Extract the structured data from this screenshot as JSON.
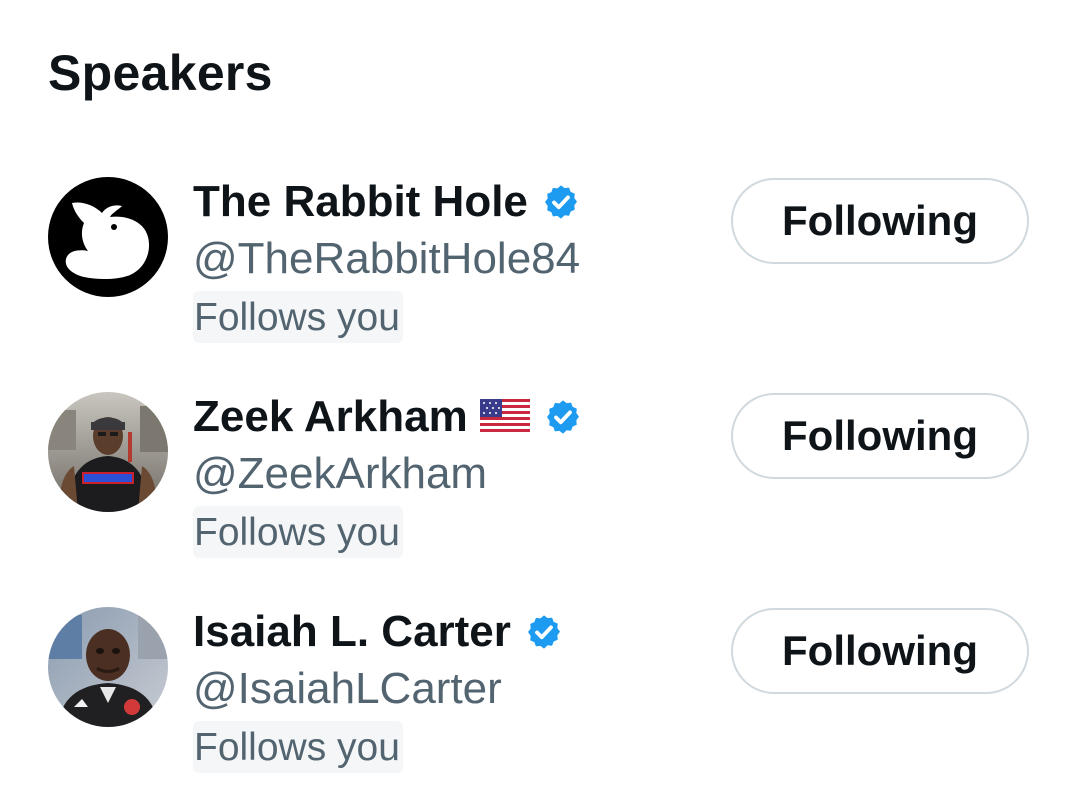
{
  "section": {
    "title": "Speakers"
  },
  "speakers": [
    {
      "display_name": "The Rabbit Hole",
      "handle": "@TheRabbitHole84",
      "follows_you": "Follows you",
      "button_label": "Following",
      "verified": true,
      "avatar_icon": "rabbit-logo",
      "flag_icon": null
    },
    {
      "display_name": "Zeek Arkham",
      "handle": "@ZeekArkham",
      "follows_you": "Follows you",
      "button_label": "Following",
      "verified": true,
      "avatar_icon": "user-photo",
      "flag_icon": "us-flag"
    },
    {
      "display_name": "Isaiah L. Carter",
      "handle": "@IsaiahLCarter",
      "follows_you": "Follows you",
      "button_label": "Following",
      "verified": true,
      "avatar_icon": "user-photo",
      "flag_icon": null
    }
  ],
  "colors": {
    "verified_badge": "#1d9bf0",
    "secondary_text": "#536471",
    "button_border": "#cfd9de",
    "primary_text": "#0f1419"
  }
}
